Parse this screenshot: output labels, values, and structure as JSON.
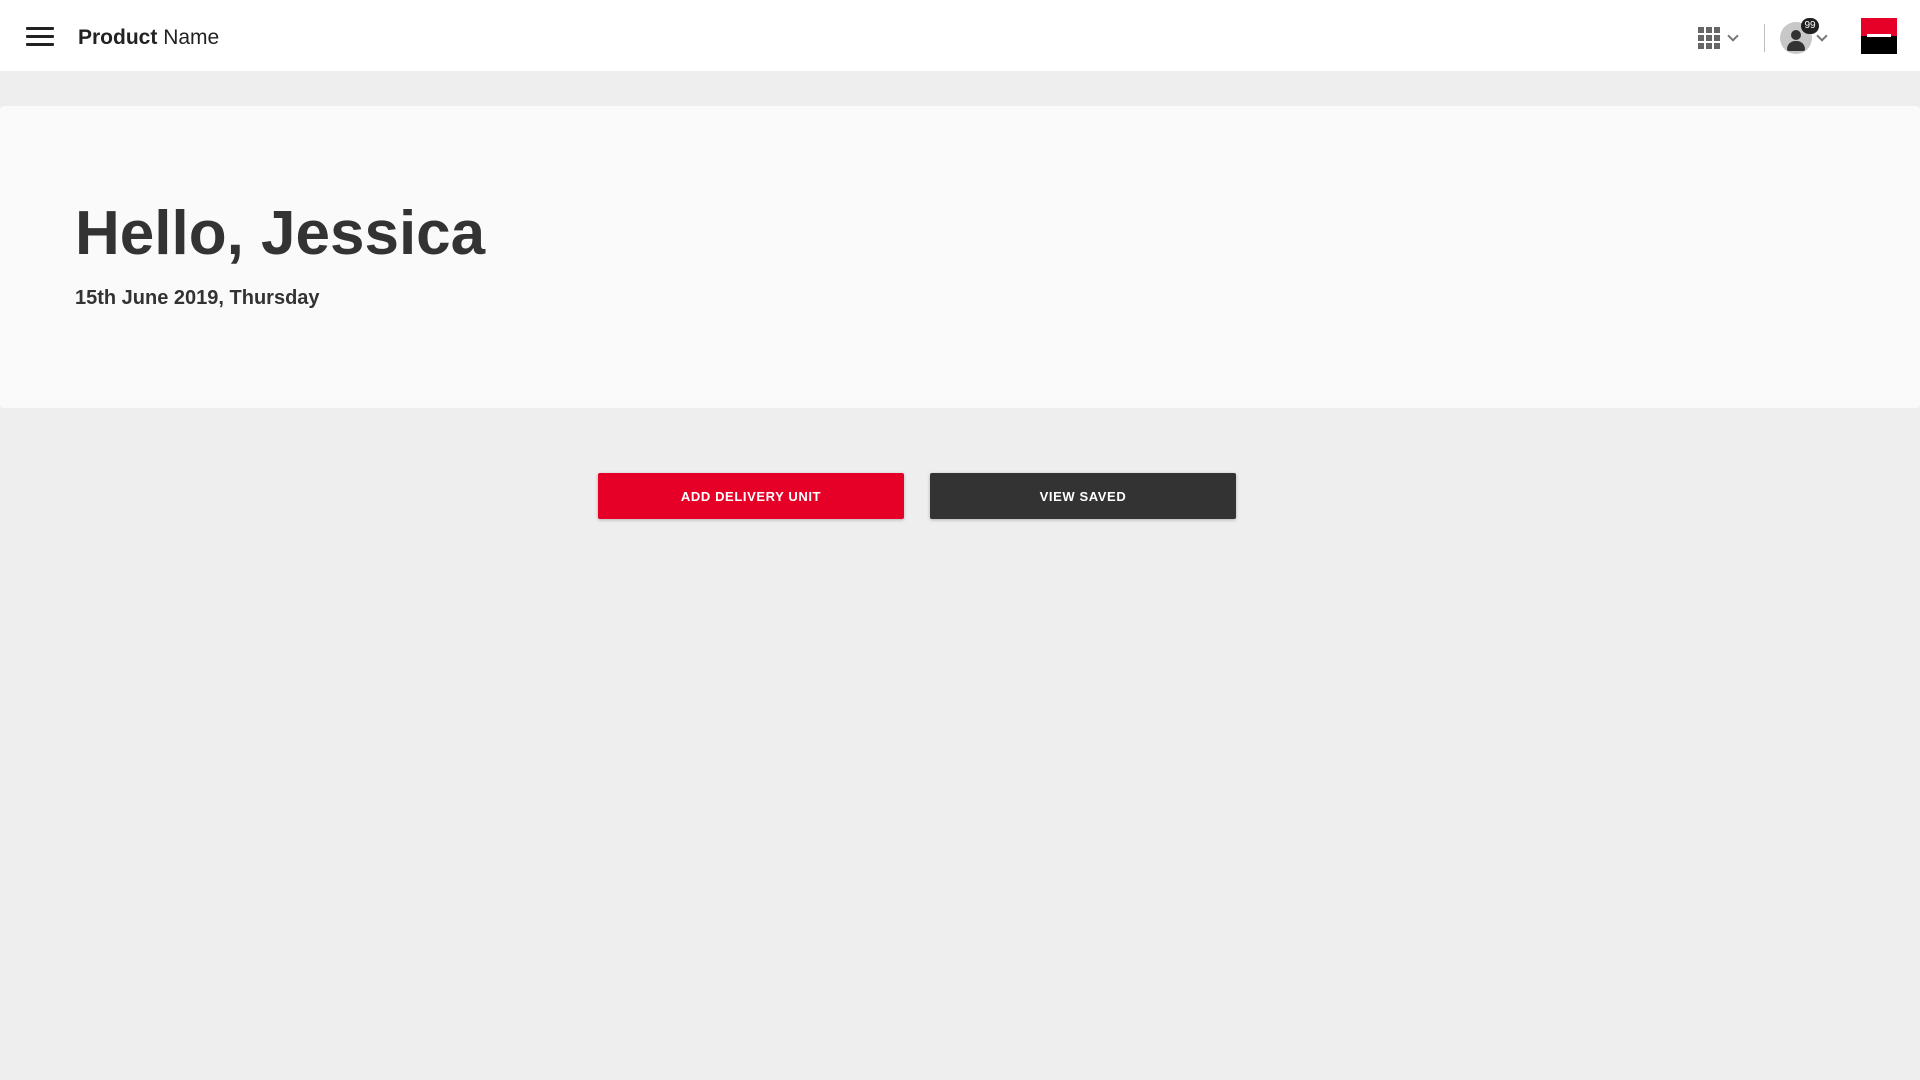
{
  "header": {
    "product_name_bold": "Product",
    "product_name_light": "Name",
    "notification_count": "99",
    "icons": {
      "menu": "hamburger-menu-icon",
      "apps": "apps-grid-icon",
      "user": "user-avatar-icon",
      "brand": "brand-logo"
    }
  },
  "greeting": {
    "title": "Hello, Jessica",
    "date": "15th June 2019, Thursday"
  },
  "actions": {
    "add_delivery_unit": "ADD DELIVERY UNIT",
    "view_saved": "VIEW SAVED"
  },
  "colors": {
    "brand_red": "#e60028",
    "dark": "#333333",
    "page_background": "#eeeeee",
    "card_background": "#fafafa"
  }
}
